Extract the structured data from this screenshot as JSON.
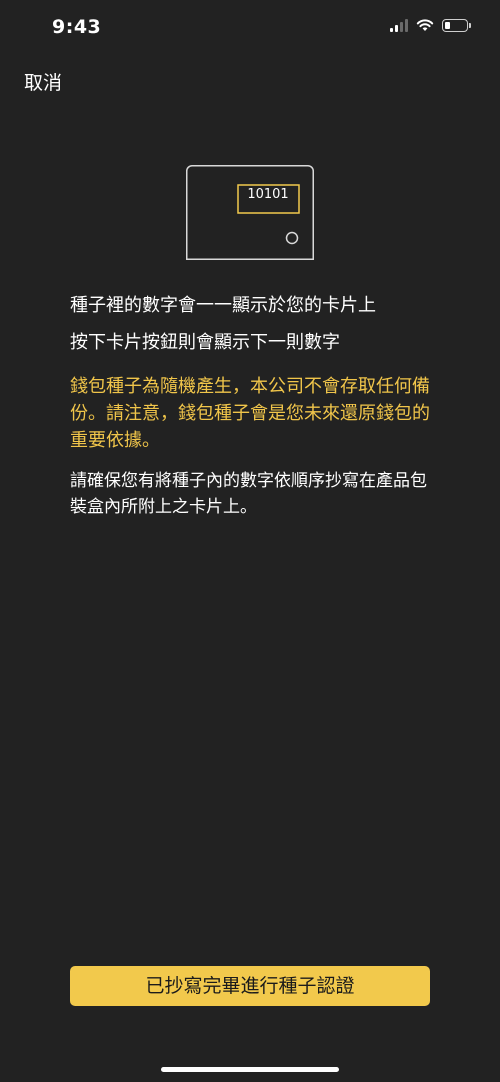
{
  "status_bar": {
    "time": "9:43",
    "icons": [
      "cellular-signal-icon",
      "wifi-icon",
      "battery-icon"
    ],
    "battery_level": 0.25
  },
  "header": {
    "cancel_label": "取消"
  },
  "illustration": {
    "icon": "card-device-icon",
    "card_number": "10101"
  },
  "content": {
    "line1": "種子裡的數字會一一顯示於您的卡片上",
    "line2": "按下卡片按鈕則會顯示下一則數字",
    "warning": "錢包種子為隨機產生，本公司不會存取任何備份。請注意，錢包種子會是您未來還原錢包的重要依據。",
    "note": "請確保您有將種子內的數字依順序抄寫在產品包裝盒內所附上之卡片上。"
  },
  "footer": {
    "confirm_label": "已抄寫完畢進行種子認證"
  },
  "colors": {
    "background": "#222222",
    "accent": "#f2c94c",
    "warning_text": "#f0c54a"
  }
}
